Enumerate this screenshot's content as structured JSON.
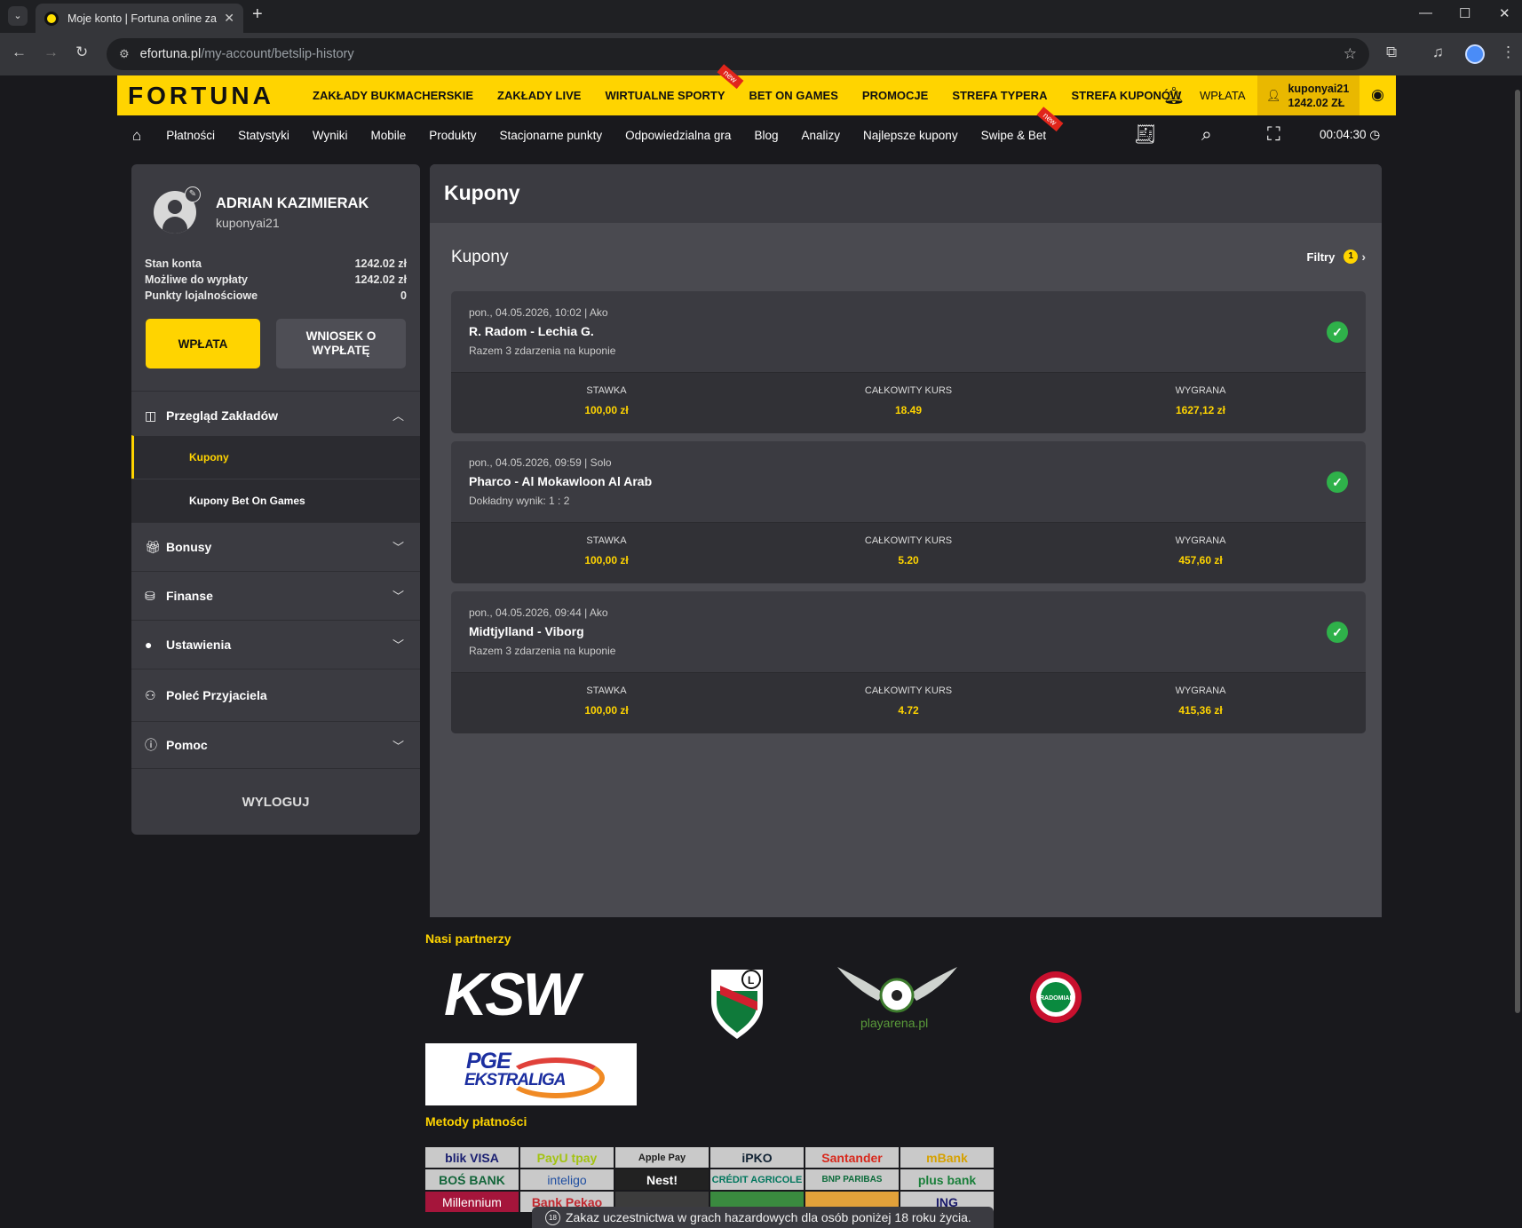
{
  "browser": {
    "tab_title": "Moje konto | Fortuna online zakłady",
    "url_host": "efortuna.pl",
    "url_path": "/my-account/betslip-history",
    "icons": [
      "tab-search-icon",
      "favicon",
      "close-tab-icon",
      "new-tab-icon",
      "back-icon",
      "forward-icon",
      "reload-icon",
      "site-info-icon",
      "bookmark-star-icon",
      "extensions-icon",
      "media-icon",
      "profile-icon",
      "menu-icon"
    ]
  },
  "header": {
    "logo": "FORTUNA",
    "main_menu": [
      {
        "label": "ZAKŁADY BUKMACHERSKIE"
      },
      {
        "label": "ZAKŁADY LIVE"
      },
      {
        "label": "WIRTUALNE SPORTY",
        "badge": "new"
      },
      {
        "label": "BET ON GAMES"
      },
      {
        "label": "PROMOCJE"
      },
      {
        "label": "STREFA TYPERA"
      },
      {
        "label": "STREFA KUPONÓW"
      }
    ],
    "deposit_label": "WPŁATA",
    "user_login": "kuponyai21",
    "user_balance": "1242.02 ZŁ",
    "sub_menu": [
      {
        "label": "Płatności"
      },
      {
        "label": "Statystyki"
      },
      {
        "label": "Wyniki"
      },
      {
        "label": "Mobile"
      },
      {
        "label": "Produkty"
      },
      {
        "label": "Stacjonarne punkty"
      },
      {
        "label": "Odpowiedzialna gra"
      },
      {
        "label": "Blog"
      },
      {
        "label": "Analizy"
      },
      {
        "label": "Najlepsze kupony"
      },
      {
        "label": "Swipe & Bet",
        "badge": "new"
      }
    ],
    "session_timer": "00:04:30"
  },
  "sidebar": {
    "full_name": "ADRIAN KAZIMIERAK",
    "login": "kuponyai21",
    "balances": [
      {
        "label": "Stan konta",
        "value": "1242.02 zł"
      },
      {
        "label": "Możliwe do wypłaty",
        "value": "1242.02 zł"
      },
      {
        "label": "Punkty lojalnościowe",
        "value": "0"
      }
    ],
    "deposit_button": "WPŁATA",
    "withdraw_button_line1": "WNIOSEK O",
    "withdraw_button_line2": "WYPŁATĘ",
    "menu": [
      {
        "label": "Przegląd Zakładów",
        "icon": "bets-overview-icon",
        "expanded": true
      },
      {
        "label": "Bonusy",
        "icon": "gift-icon"
      },
      {
        "label": "Finanse",
        "icon": "finance-icon"
      },
      {
        "label": "Ustawienia",
        "icon": "user-settings-icon"
      },
      {
        "label": "Poleć Przyjaciela",
        "icon": "refer-friend-icon"
      },
      {
        "label": "Pomoc",
        "icon": "help-icon"
      }
    ],
    "submenu": [
      {
        "label": "Kupony",
        "active": true
      },
      {
        "label": "Kupony Bet On Games"
      }
    ],
    "logout": "WYLOGUJ"
  },
  "main": {
    "page_title": "Kupony",
    "section_title": "Kupony",
    "filters_label": "Filtry",
    "filters_count": "1",
    "stake_label": "STAWKA",
    "odds_label": "CAŁKOWITY KURS",
    "win_label": "WYGRANA",
    "coupons": [
      {
        "meta": "pon., 04.05.2026, 10:02 | Ako",
        "match": "R. Radom - Lechia G.",
        "desc": "Razem 3 zdarzenia na kuponie",
        "stake": "100,00 zł",
        "odds": "18.49",
        "win": "1627,12 zł",
        "status": "won"
      },
      {
        "meta": "pon., 04.05.2026, 09:59 | Solo",
        "match": "Pharco - Al Mokawloon Al Arab",
        "desc": "Dokładny wynik: 1 : 2",
        "stake": "100,00 zł",
        "odds": "5.20",
        "win": "457,60 zł",
        "status": "won"
      },
      {
        "meta": "pon., 04.05.2026, 09:44 | Ako",
        "match": "Midtjylland - Viborg",
        "desc": "Razem 3 zdarzenia na kuponie",
        "stake": "100,00 zł",
        "odds": "4.72",
        "win": "415,36 zł",
        "status": "won"
      }
    ]
  },
  "footer": {
    "partners_title": "Nasi partnerzy",
    "partners": [
      "KSW",
      "Legia",
      "playarena.pl",
      "RKS Radomiak",
      "PGE EKSTRALIGA"
    ],
    "partner_sublabels": {
      "playarena": "playarena.pl",
      "radomiak": "RADOMIAK",
      "pge_line1": "PGE",
      "pge_line2": "EKSTRALIGA"
    },
    "payments_title": "Metody płatności",
    "payments": [
      "blik VISA",
      "PayU tpay",
      "Apple Pay",
      "iPKO",
      "Santander",
      "mBank",
      "BOŚ BANK",
      "inteligo",
      "Nest!",
      "CRÉDIT AGRICOLE",
      "BNP PARIBAS",
      "plus bank",
      "Millennium",
      "Bank Pekao",
      "",
      "",
      "",
      "ING"
    ],
    "age_badge": "18",
    "age_warning": "Zakaz uczestnictwa w grach hazardowych dla osób poniżej 18 roku życia."
  },
  "colors": {
    "brand_yellow": "#ffd400",
    "panel": "#3b3b41",
    "success": "#2fb14a"
  }
}
